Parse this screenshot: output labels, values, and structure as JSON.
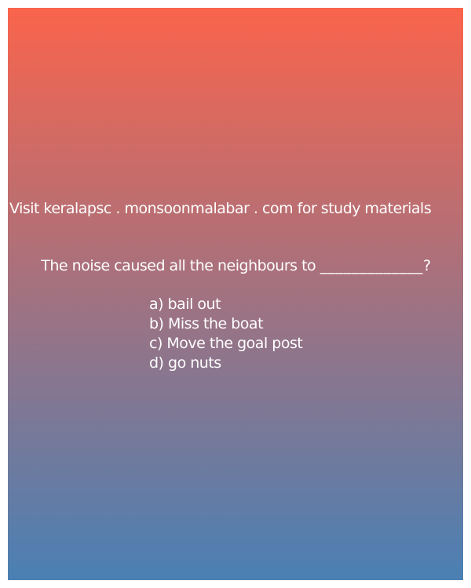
{
  "promo_text": "Visit keralapsc . monsoonmalabar . com for study materials",
  "question": {
    "text": "The noise caused all the neighbours to",
    "blank": "_____________?"
  },
  "options": [
    {
      "label": "a) bail out"
    },
    {
      "label": "b) Miss the boat"
    },
    {
      "label": "c) Move the goal post"
    },
    {
      "label": "d) go nuts"
    }
  ],
  "colors": {
    "gradient_top": "#fa644c",
    "gradient_bottom": "#4a80b4",
    "text": "#ffffff"
  }
}
